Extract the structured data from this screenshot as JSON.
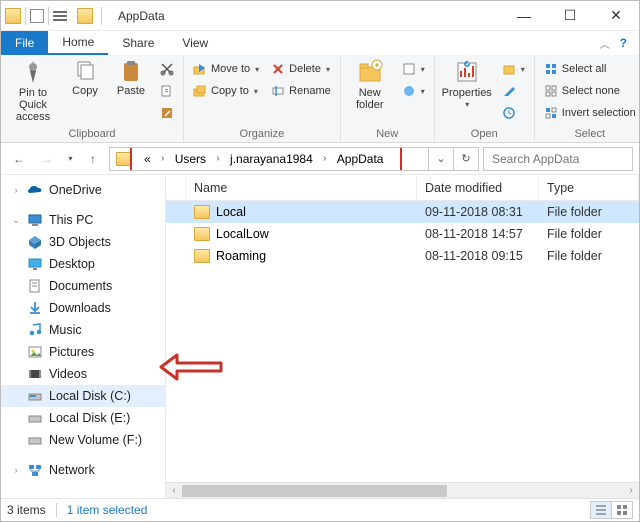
{
  "title": "AppData",
  "tabs": {
    "file": "File",
    "home": "Home",
    "share": "Share",
    "view": "View"
  },
  "ribbon": {
    "clipboard": {
      "label": "Clipboard",
      "pin": "Pin to Quick access",
      "copy": "Copy",
      "paste": "Paste"
    },
    "organize": {
      "label": "Organize",
      "move": "Move to",
      "copy": "Copy to",
      "delete": "Delete",
      "rename": "Rename"
    },
    "new": {
      "label": "New",
      "newfolder": "New folder"
    },
    "open": {
      "label": "Open",
      "properties": "Properties"
    },
    "select": {
      "label": "Select",
      "all": "Select all",
      "none": "Select none",
      "invert": "Invert selection"
    }
  },
  "breadcrumb": {
    "overflow": "«",
    "seg1": "Users",
    "seg2": "j.narayana1984",
    "seg3": "AppData"
  },
  "search": {
    "placeholder": "Search AppData"
  },
  "tree": {
    "onedrive": "OneDrive",
    "thispc": "This PC",
    "obj3d": "3D Objects",
    "desktop": "Desktop",
    "documents": "Documents",
    "downloads": "Downloads",
    "music": "Music",
    "pictures": "Pictures",
    "videos": "Videos",
    "c": "Local Disk (C:)",
    "e": "Local Disk (E:)",
    "f": "New Volume (F:)",
    "network": "Network"
  },
  "columns": {
    "name": "Name",
    "date": "Date modified",
    "type": "Type"
  },
  "rows": [
    {
      "name": "Local",
      "date": "09-11-2018 08:31",
      "type": "File folder"
    },
    {
      "name": "LocalLow",
      "date": "08-11-2018 14:57",
      "type": "File folder"
    },
    {
      "name": "Roaming",
      "date": "08-11-2018 09:15",
      "type": "File folder"
    }
  ],
  "status": {
    "items": "3 items",
    "selected": "1 item selected"
  }
}
